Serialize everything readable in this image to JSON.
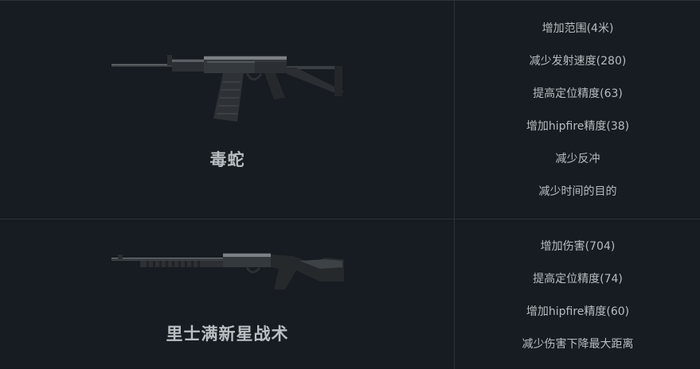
{
  "weapons": [
    {
      "name": "毒蛇",
      "image_icon": "assault-rifle-icon",
      "stats": [
        "增加范围(4米)",
        "减少发射速度(280)",
        "提高定位精度(63)",
        "增加hipfire精度(38)",
        "减少反冲",
        "减少时间的目的"
      ]
    },
    {
      "name": "里士满新星战术",
      "image_icon": "shotgun-icon",
      "stats": [
        "增加伤害(704)",
        "提高定位精度(74)",
        "增加hipfire精度(60)",
        "减少伤害下降最大距离"
      ]
    }
  ],
  "colors": {
    "background": "#161c21",
    "border": "#2a3238",
    "text": "#b7bcc0"
  }
}
